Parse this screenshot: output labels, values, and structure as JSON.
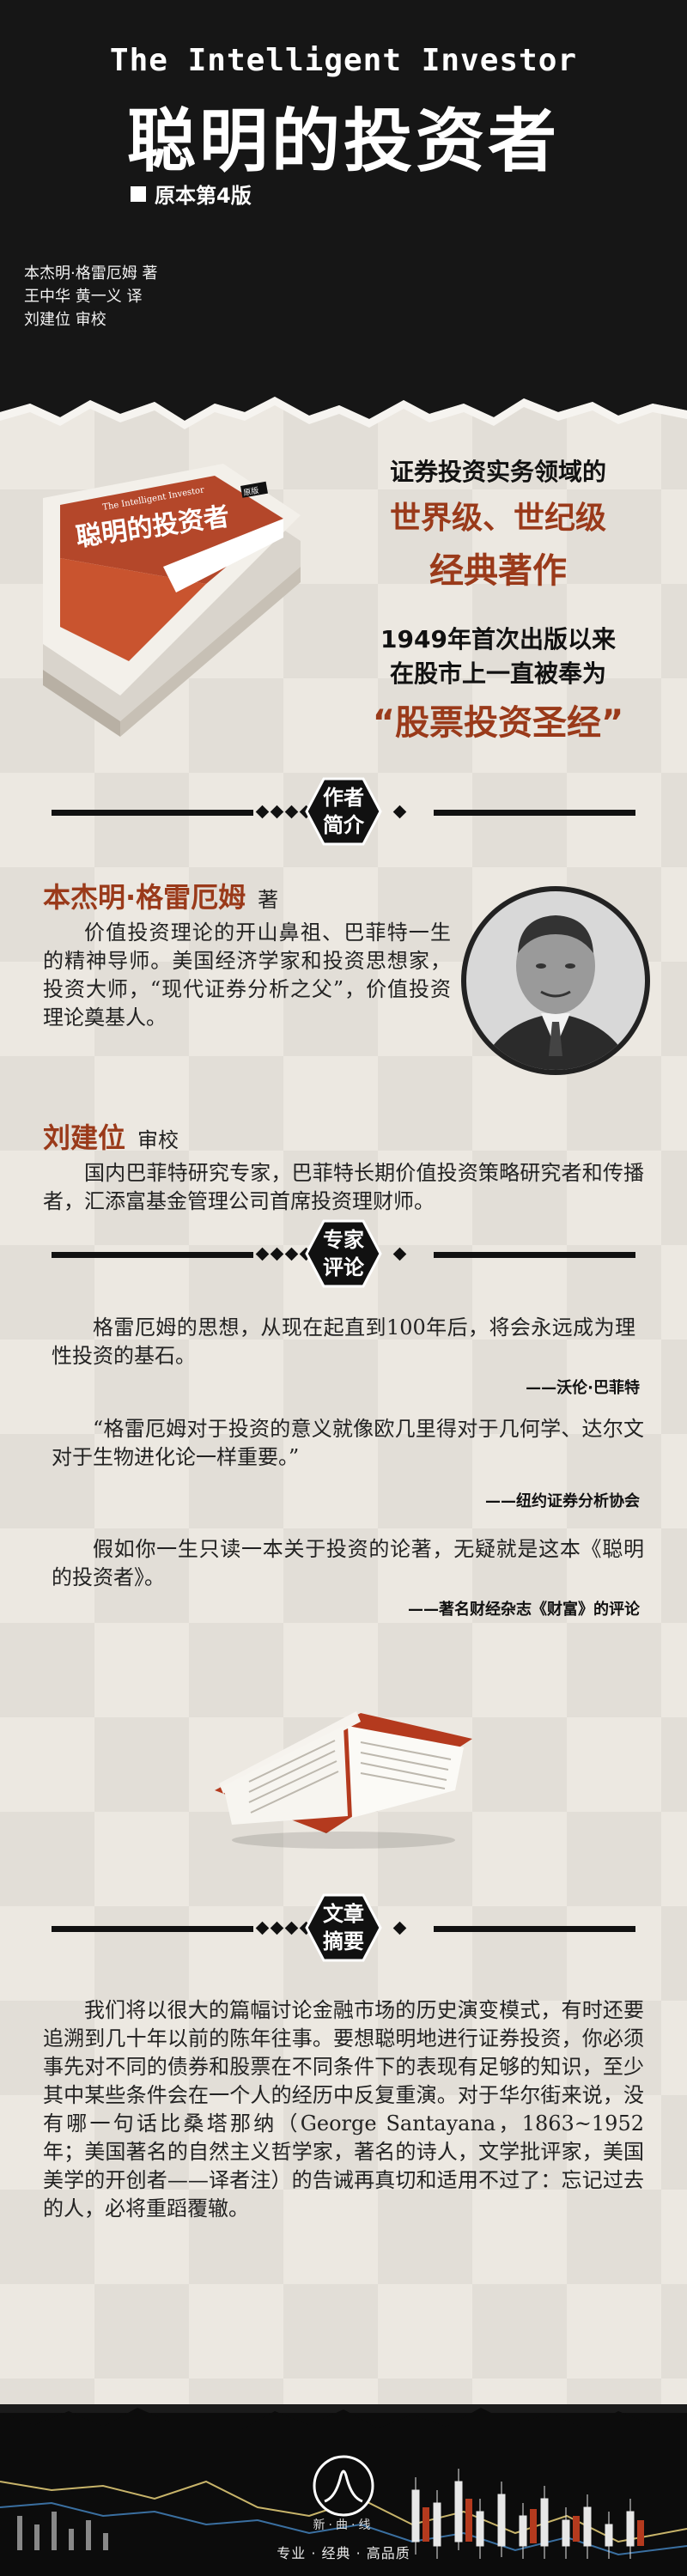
{
  "header": {
    "title_en": "The Intelligent Investor",
    "title_cn": "聪明的投资者",
    "edition": "原本第4版",
    "credits": [
      "本杰明·格雷厄姆 著",
      "王中华 黄一义 译",
      "刘建位 审校"
    ]
  },
  "hero": {
    "line1": "证券投资实务领域的",
    "line2": "世界级、世纪级",
    "line3": "经典著作",
    "line4a": "1949年首次出版以来",
    "line4b": "在股市上一直被奉为",
    "line5": "“股票投资圣经”"
  },
  "book_cover": {
    "title": "聪明的投资者",
    "title_en": "The Intelligent Investor",
    "badge": "原版"
  },
  "sections": {
    "author": {
      "label_line1": "作者",
      "label_line2": "简介"
    },
    "comments": {
      "label_line1": "专家",
      "label_line2": "评论"
    },
    "abstract": {
      "label_line1": "文章",
      "label_line2": "摘要"
    }
  },
  "authors": [
    {
      "name": "本杰明·格雷厄姆",
      "role": "著",
      "bio": "价值投资理论的开山鼻祖、巴菲特一生的精神导师。美国经济学家和投资思想家，投资大师，“现代证券分析之父”，价值投资理论奠基人。"
    },
    {
      "name": "刘建位",
      "role": "审校",
      "bio": "国内巴菲特研究专家，巴菲特长期价值投资策略研究者和传播者，汇添富基金管理公司首席投资理财师。"
    }
  ],
  "comments": [
    {
      "text": "格雷厄姆的思想，从现在起直到100年后，将会永远成为理性投资的基石。",
      "source": "——沃伦·巴菲特"
    },
    {
      "text": "“格雷厄姆对于投资的意义就像欧几里得对于几何学、达尔文对于生物进化论一样重要。”",
      "source": "——纽约证券分析协会"
    },
    {
      "text": "假如你一生只读一本关于投资的论著，无疑就是这本《聪明的投资者》。",
      "source": "——著名财经杂志《财富》的评论"
    }
  ],
  "abstract": {
    "text": "我们将以很大的篇幅讨论金融市场的历史演变模式，有时还要追溯到几十年以前的陈年往事。要想聪明地进行证券投资，你必须事先对不同的债券和股票在不同条件下的表现有足够的知识，至少其中某些条件会在一个人的经历中反复重演。对于华尔街来说，没有哪一句话比桑塔那纳（George Santayana，1863~1952年；美国著名的自然主义哲学家，著名的诗人，文学批评家，美国美学的开创者——译者注）的告诫再真切和适用不过了：忘记过去的人，必将重蹈覆辙。"
  },
  "footer": {
    "logo_text": "新·曲·线",
    "slogan": "专业 · 经典 · 高品质"
  },
  "colors": {
    "accent": "#9a3a1a",
    "dark": "#161616",
    "paper": "#ece8e1"
  }
}
